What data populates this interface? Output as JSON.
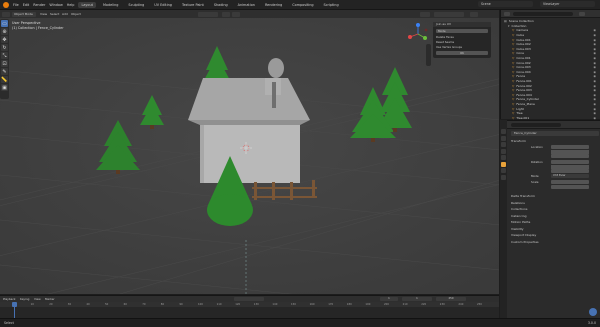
{
  "app": {
    "logo": "blender-logo-icon",
    "menus": [
      "File",
      "Edit",
      "Render",
      "Window",
      "Help"
    ],
    "workspace_tabs": [
      "Layout",
      "Modeling",
      "Sculpting",
      "UV Editing",
      "Texture Paint",
      "Shading",
      "Animation",
      "Rendering",
      "Compositing",
      "Scripting"
    ],
    "active_tab": "Layout",
    "scene": "Scene",
    "view_layer": "ViewLayer"
  },
  "viewport": {
    "mode": "Object Mode",
    "view_menus": [
      "View",
      "Select",
      "Add",
      "Object"
    ],
    "info_line1": "User Perspective",
    "info_line2": "(1) Collection | Fence_Cylinder",
    "background_color": "#3f3f3f"
  },
  "operator_panel": {
    "title": "Join as UV",
    "fields": [
      "Mode",
      "Delete Faces",
      "Reset Seams",
      "Use Vertex Groups"
    ],
    "button": "OK"
  },
  "outliner": {
    "header": "Scene Collection",
    "collection": "Collection",
    "items": [
      "Camera",
      "Cube",
      "Cube.001",
      "Cube.002",
      "Cube.003",
      "Cone",
      "Cone.001",
      "Cone.002",
      "Cone.003",
      "Cone.004",
      "Fence",
      "Fence.001",
      "Fence.002",
      "Fence.003",
      "Fence.004",
      "Fence_Cylinder",
      "Fence_Plane",
      "Light",
      "Tree",
      "Tree.001",
      "Tree.002"
    ]
  },
  "properties": {
    "object_name": "Fence_Cylinder",
    "sections": [
      "Transform",
      "Delta Transform",
      "Relations",
      "Collections",
      "Instancing",
      "Motion Paths",
      "Visibility",
      "Viewport Display",
      "Custom Properties"
    ],
    "location_label": "Location",
    "rotation_label": "Rotation",
    "scale_label": "Scale",
    "mode_label": "Mode",
    "mode_value": "XYZ Euler"
  },
  "timeline": {
    "menus": [
      "Playback",
      "Keying",
      "View",
      "Marker"
    ],
    "start": "1",
    "end": "250",
    "current_frame": "1",
    "ticks": [
      "0",
      "10",
      "20",
      "30",
      "40",
      "50",
      "60",
      "70",
      "80",
      "90",
      "100",
      "110",
      "120",
      "130",
      "140",
      "150",
      "160",
      "170",
      "180",
      "190",
      "200",
      "210",
      "220",
      "230",
      "240",
      "250"
    ]
  },
  "status": {
    "left": "Select",
    "version": "3.0.0"
  },
  "colors": {
    "accent": "#4772b3",
    "tree": "#2f8a2f",
    "house": "#b9b9b9",
    "fence": "#7a5636"
  }
}
